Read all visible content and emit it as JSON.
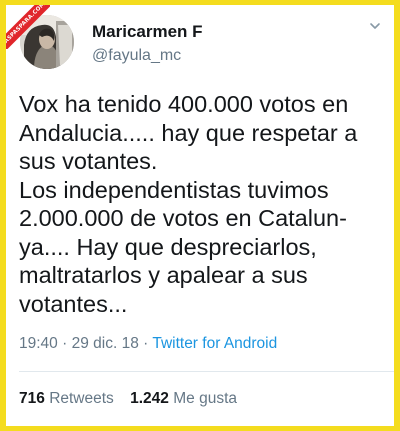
{
  "watermark": {
    "text": "ASPASPARA.COM",
    "color": "#e0262b"
  },
  "user": {
    "display_name": "Maricarmen F",
    "handle": "@fayula_mc"
  },
  "tweet": {
    "lines": [
      "Vox ha tenido 400.000 votos en",
      "Andalucia..... hay que respetar a",
      "sus votantes.",
      "Los independentistas tuvimos",
      "2.000.000 de votos en Catalun-",
      "ya.... Hay que despreciarlos,",
      "maltratarlos y apalear a sus",
      "votantes..."
    ],
    "time": "19:40",
    "separator": "·",
    "date": "29 dic. 18",
    "source": "Twitter for Android"
  },
  "stats": {
    "retweets_count": "716",
    "retweets_label": "Retweets",
    "likes_count": "1.242",
    "likes_label": "Me gusta"
  },
  "icons": {
    "menu": "chevron-down-icon",
    "avatar": "profile-photo"
  },
  "colors": {
    "border": "#f4dc1e",
    "link": "#1b95e0",
    "muted": "#657786",
    "text": "#14171a"
  }
}
